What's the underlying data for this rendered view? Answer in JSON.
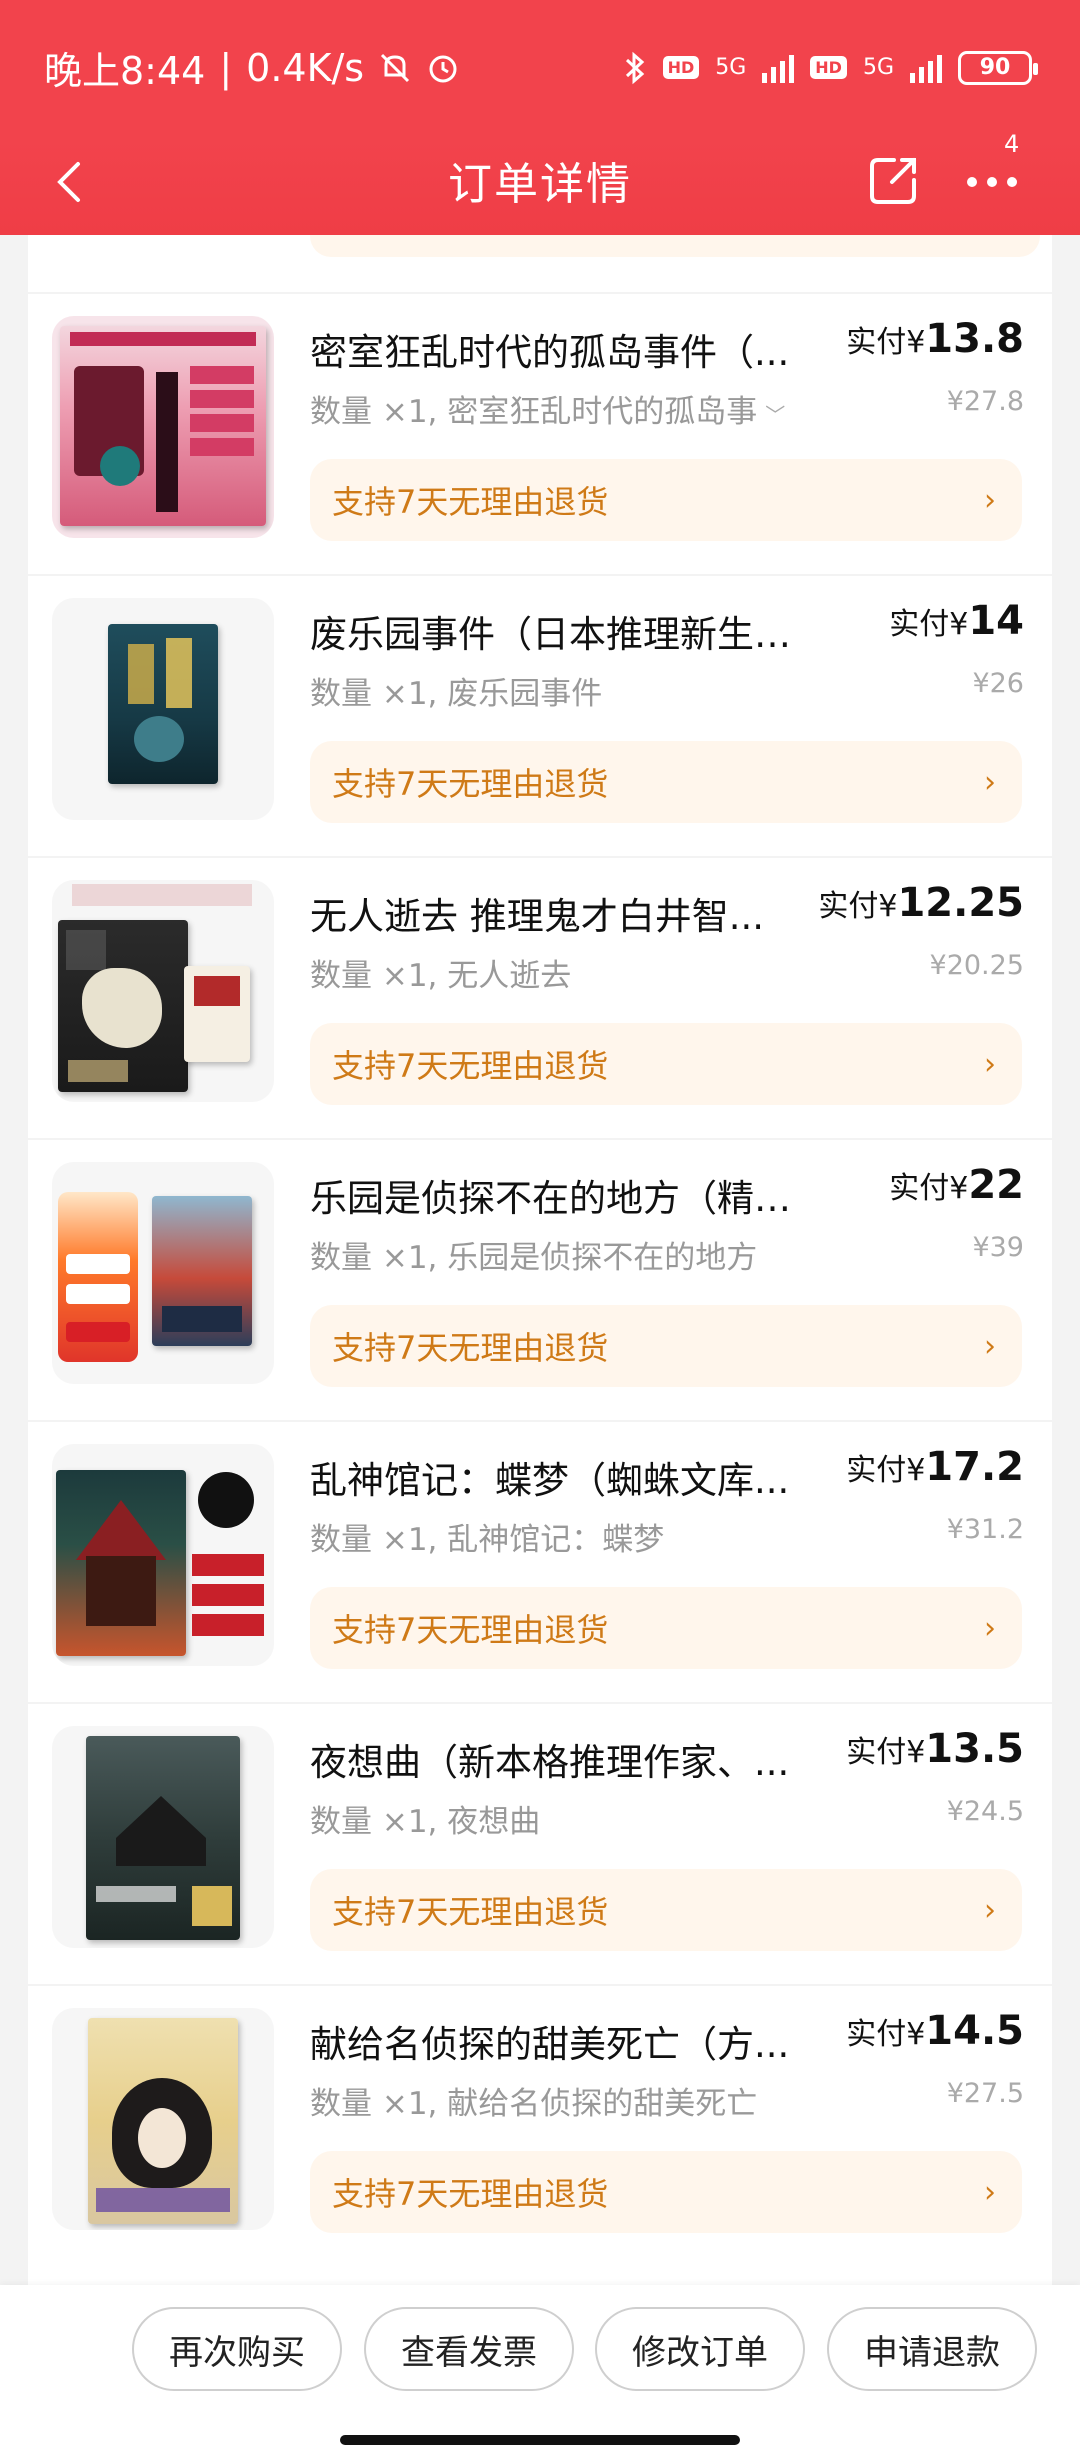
{
  "status_bar": {
    "time": "晚上8:44",
    "speed": "0.4K/s",
    "hd1": "HD",
    "net1": "5G",
    "hd2": "HD",
    "net2": "5G",
    "battery": "90"
  },
  "nav": {
    "title": "订单详情",
    "more_badge": "4"
  },
  "items": [
    {
      "title": "密室狂乱时代的孤岛事件（...",
      "paid_label": "实付",
      "currency": "¥",
      "paid_amount": "13.8",
      "qty_label": "数量 ×1, 密室狂乱时代的孤岛事",
      "has_chevron": true,
      "original_price": "¥27.8",
      "refund_label": "支持7天无理由退货"
    },
    {
      "title": "废乐园事件（日本推理新生代...",
      "paid_label": "实付",
      "currency": "¥",
      "paid_amount": "14",
      "qty_label": "数量 ×1, 废乐园事件",
      "original_price": "¥26",
      "refund_label": "支持7天无理由退货"
    },
    {
      "title": "无人逝去 推理鬼才白井智...",
      "paid_label": "实付",
      "currency": "¥",
      "paid_amount": "12.25",
      "qty_label": "数量 ×1, 无人逝去",
      "original_price": "¥20.25",
      "refund_label": "支持7天无理由退货"
    },
    {
      "title": "乐园是侦探不在的地方（精装...",
      "paid_label": "实付",
      "currency": "¥",
      "paid_amount": "22",
      "qty_label": "数量 ×1, 乐园是侦探不在的地方",
      "original_price": "¥39",
      "refund_label": "支持7天无理由退货"
    },
    {
      "title": "乱神馆记：蝶梦（蜘蛛文库...",
      "paid_label": "实付",
      "currency": "¥",
      "paid_amount": "17.2",
      "qty_label": "数量 ×1, 乱神馆记：蝶梦",
      "original_price": "¥31.2",
      "refund_label": "支持7天无理由退货"
    },
    {
      "title": "夜想曲（新本格推理作家、...",
      "paid_label": "实付",
      "currency": "¥",
      "paid_amount": "13.5",
      "qty_label": "数量 ×1, 夜想曲",
      "original_price": "¥24.5",
      "refund_label": "支持7天无理由退货"
    },
    {
      "title": "献给名侦探的甜美死亡（方...",
      "paid_label": "实付",
      "currency": "¥",
      "paid_amount": "14.5",
      "qty_label": "数量 ×1, 献给名侦探的甜美死亡",
      "original_price": "¥27.5",
      "refund_label": "支持7天无理由退货"
    }
  ],
  "actions": {
    "buy_again": "再次购买",
    "view_invoice": "查看发票",
    "modify_order": "修改订单",
    "request_refund": "申请退款"
  },
  "colors": {
    "header_red": "#f2434c",
    "refund_bg": "#fff6ec",
    "refund_text": "#cf7a17"
  },
  "icons": {
    "back": "back-arrow-icon",
    "share": "share-icon",
    "more": "more-dots-icon",
    "refund_arrow": "chevron-right-icon"
  }
}
